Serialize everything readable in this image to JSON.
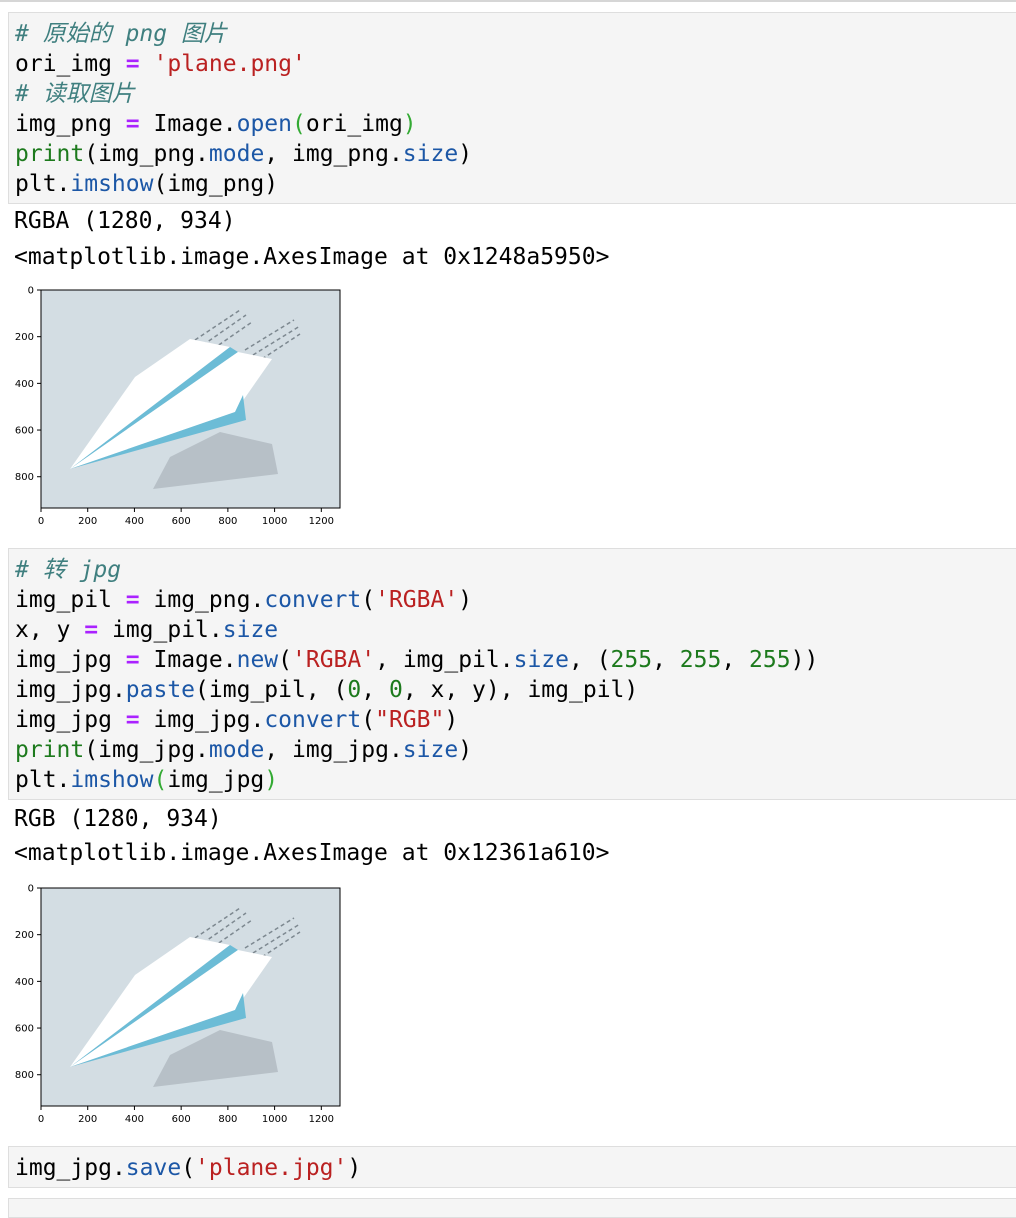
{
  "cells": [
    {
      "comment1": "# 原始的 png 图片",
      "tokens": {
        "ori_img": "ori_img",
        "eq": "=",
        "filename": "'plane.png'",
        "comment2": "# 读取图片",
        "img_png": "img_png",
        "Image": "Image.",
        "open": "open",
        "lp": "(",
        "rp": ")",
        "print": "print",
        "mode": "mode",
        "size": "size",
        "plt": "plt.",
        "imshow": "imshow"
      },
      "output_text": "RGBA (1280, 934)",
      "repr": "<matplotlib.image.AxesImage at 0x1248a5950>"
    },
    {
      "comment1": "# 转 jpg",
      "tokens": {
        "img_pil": "img_pil",
        "convert": "convert",
        "rgba": "'RGBA'",
        "new": "new",
        "n255": "255",
        "n0": "0",
        "rgb": "\"RGB\"",
        "paste": "paste",
        "img_jpg": "img_jpg",
        "xy": "x, y"
      },
      "output_text": "RGB (1280, 934)",
      "repr": "<matplotlib.image.AxesImage at 0x12361a610>"
    },
    {
      "save_filename": "'plane.jpg'",
      "save": "save"
    }
  ],
  "axes": {
    "x_ticks": [
      "0",
      "200",
      "400",
      "600",
      "800",
      "1000",
      "1200"
    ],
    "y_ticks": [
      "0",
      "200",
      "400",
      "600",
      "800"
    ]
  },
  "colors": {
    "sky": "#d3dde3",
    "fold": "#6cbcd6",
    "shadow": "#b7c0c7"
  }
}
